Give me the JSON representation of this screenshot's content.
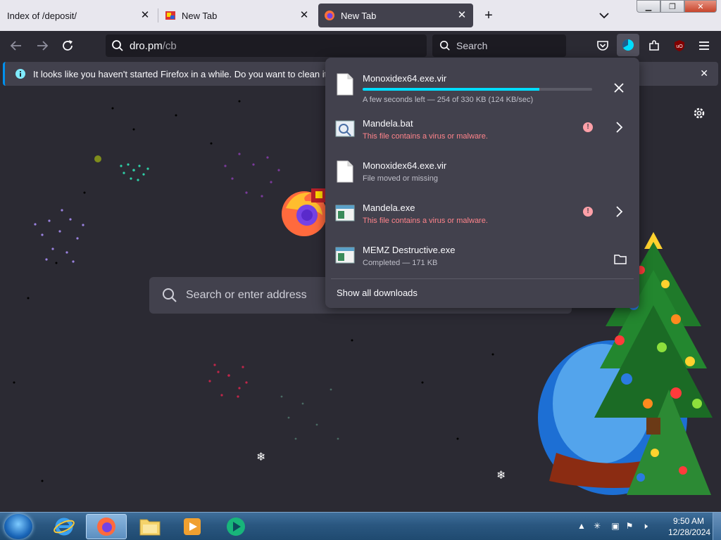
{
  "tabs": [
    {
      "title": "Index of /deposit/"
    },
    {
      "title": "New Tab"
    },
    {
      "title": "New Tab"
    }
  ],
  "urlbar": {
    "host": "dro.pm",
    "path": "/cb"
  },
  "searchbar": {
    "placeholder": "Search"
  },
  "notification": {
    "text": "It looks like you haven't started Firefox in a while. Do you want to clean it up for"
  },
  "ntp": {
    "search_placeholder": "Search or enter address"
  },
  "downloads": {
    "items": [
      {
        "name": "Monoxidex64.exe.vir",
        "status": "A few seconds left — 254 of 330 KB (124 KB/sec)",
        "progress": 0.77
      },
      {
        "name": "Mandela.bat",
        "status": "This file contains a virus or malware."
      },
      {
        "name": "Monoxidex64.exe.vir",
        "status": "File moved or missing"
      },
      {
        "name": "Mandela.exe",
        "status": "This file contains a virus or malware."
      },
      {
        "name": "MEMZ Destructive.exe",
        "status": "Completed — 171 KB"
      }
    ],
    "show_all": "Show all downloads"
  },
  "taskbar": {
    "time": "9:50 AM",
    "date": "12/28/2024"
  },
  "colors": {
    "accent": "#00ddff",
    "danger": "#ff848b",
    "panel": "#42414d",
    "bg": "#2b2a33"
  }
}
